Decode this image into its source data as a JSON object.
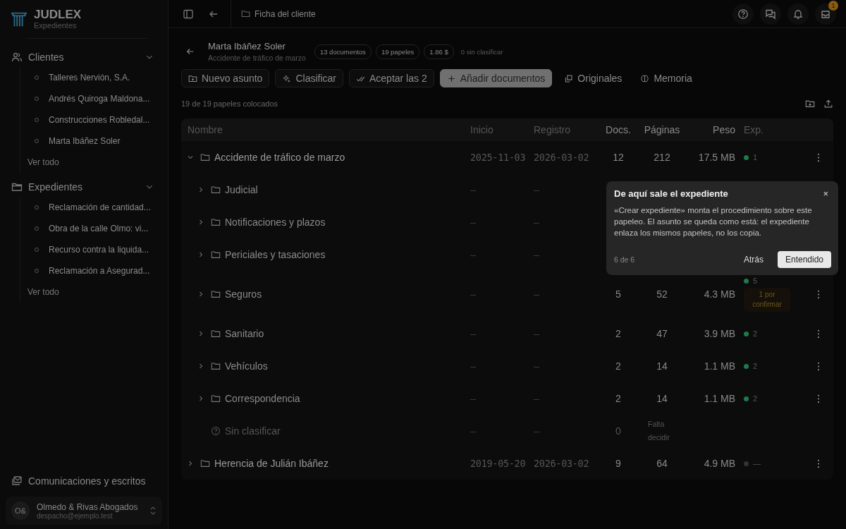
{
  "brand": {
    "name": "JUDLEX",
    "subtitle": "Expedientes"
  },
  "sidebar": {
    "sections": [
      {
        "title": "Clientes",
        "kind": "people",
        "expanded": true,
        "items": [
          "Talleres Nervión, S.A.",
          "Andrés Quiroga Maldona...",
          "Construcciones Robledal...",
          "Marta Ibáñez Soler"
        ],
        "more": "Ver todo"
      },
      {
        "title": "Expedientes",
        "kind": "folder",
        "expanded": true,
        "items": [
          "Reclamación de cantidad...",
          "Obra de la calle Olmo: vi...",
          "Recurso contra la liquida...",
          "Reclamación a Asegurad..."
        ],
        "more": "Ver todo"
      }
    ],
    "footer_link": "Comunicaciones y escritos",
    "account": {
      "initials": "O&",
      "name": "Olmedo & Rivas Abogados",
      "email": "despacho@ejemplo.test"
    }
  },
  "topbar": {
    "breadcrumb": "Ficha del cliente",
    "notification_count": "1"
  },
  "header": {
    "client": "Marta Ibáñez Soler",
    "matter": "Accidente de tráfico de marzo",
    "chips": [
      "13 documentos",
      "19 papeles",
      "1.86 $"
    ],
    "unclassified": "0 sin clasificar"
  },
  "actions": [
    {
      "label": "Nuevo asunto",
      "kind": "outline"
    },
    {
      "label": "Clasificar",
      "kind": "outline"
    },
    {
      "label": "Aceptar las 2",
      "kind": "outline"
    },
    {
      "label": "Añadir documentos",
      "kind": "primary"
    },
    {
      "label": "Originales",
      "kind": "plain"
    },
    {
      "label": "Memoria",
      "kind": "plain"
    }
  ],
  "placed_status": "19 de 19 papeles colocados",
  "table": {
    "columns": [
      "Nombre",
      "Inicio",
      "Registro",
      "Docs.",
      "Páginas",
      "Peso",
      "Exp."
    ],
    "rows": [
      {
        "name": "Accidente de tráfico de marzo",
        "kind": "folder",
        "expanded": true,
        "start": "2025-11-03",
        "registered": "2026-03-02",
        "docs": "12",
        "pages": "212",
        "size": "17.5 MB",
        "exp": {
          "count": "1",
          "color": "#1f7a4a"
        },
        "children": [
          {
            "name": "Judicial",
            "kind": "folder",
            "expanded": false,
            "start": "—",
            "registered": "—"
          },
          {
            "name": "Notificaciones y plazos",
            "kind": "folder",
            "expanded": false,
            "start": "—",
            "registered": "—"
          },
          {
            "name": "Periciales y tasaciones",
            "kind": "folder",
            "expanded": false,
            "start": "—",
            "registered": "—"
          },
          {
            "name": "Seguros",
            "kind": "folder",
            "expanded": false,
            "start": "—",
            "registered": "—",
            "docs": "5",
            "pages": "52",
            "size": "4.3 MB",
            "exp": {
              "count": "5",
              "color": "#1f7a4a"
            },
            "badge": "1 por confirmar"
          },
          {
            "name": "Sanitario",
            "kind": "folder",
            "expanded": false,
            "start": "—",
            "registered": "—",
            "docs": "2",
            "pages": "47",
            "size": "3.9 MB",
            "exp": {
              "count": "2",
              "color": "#1f7a4a"
            }
          },
          {
            "name": "Vehículos",
            "kind": "folder",
            "expanded": false,
            "start": "—",
            "registered": "—",
            "docs": "2",
            "pages": "14",
            "size": "1.1 MB",
            "exp": {
              "count": "2",
              "color": "#1f7a4a"
            }
          },
          {
            "name": "Correspondencia",
            "kind": "folder",
            "expanded": false,
            "start": "—",
            "registered": "—",
            "docs": "2",
            "pages": "14",
            "size": "1.1 MB",
            "exp": {
              "count": "2",
              "color": "#1f7a4a"
            }
          },
          {
            "name": "Sin clasificar",
            "kind": "unclassified",
            "start": "—",
            "registered": "—",
            "docs": "0",
            "note": "Falta decidir"
          }
        ]
      },
      {
        "name": "Herencia de Julián Ibáñez",
        "kind": "folder",
        "expanded": false,
        "start": "2019-05-20",
        "registered": "2026-03-02",
        "docs": "9",
        "pages": "64",
        "size": "4.9 MB",
        "exp": {
          "count": "—",
          "color": "#333333"
        }
      }
    ]
  },
  "tour": {
    "title": "De aquí sale el expediente",
    "close": "×",
    "body": "«Crear expediente» monta el procedimiento sobre este papeleo. El asunto se queda como está: el expediente enlaza los mismos papeles, no los copia.",
    "step": "6 de 6",
    "back": "Atrás",
    "confirm": "Entendido"
  }
}
